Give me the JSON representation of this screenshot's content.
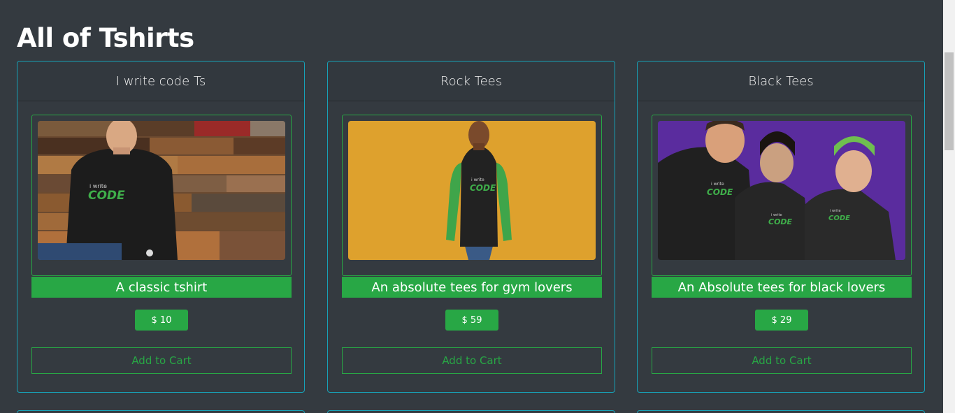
{
  "page": {
    "title": "All of Tshirts"
  },
  "products": [
    {
      "name": "I write code Ts",
      "description": "A classic tshirt",
      "price": "$ 10",
      "cart_label": "Add to Cart",
      "shirt_print_small": "i write",
      "shirt_print_large": "CODE"
    },
    {
      "name": "Rock Tees",
      "description": "An absolute tees for gym lovers",
      "price": "$ 59",
      "cart_label": "Add to Cart",
      "shirt_print_small": "i write",
      "shirt_print_large": "CODE"
    },
    {
      "name": "Black Tees",
      "description": "An Absolute tees for black lovers",
      "price": "$ 29",
      "cart_label": "Add to Cart",
      "shirt_print_small": "i write",
      "shirt_print_large": "CODE"
    }
  ],
  "colors": {
    "background": "#343a40",
    "card_border": "#17a2b8",
    "accent_green": "#28a745"
  }
}
